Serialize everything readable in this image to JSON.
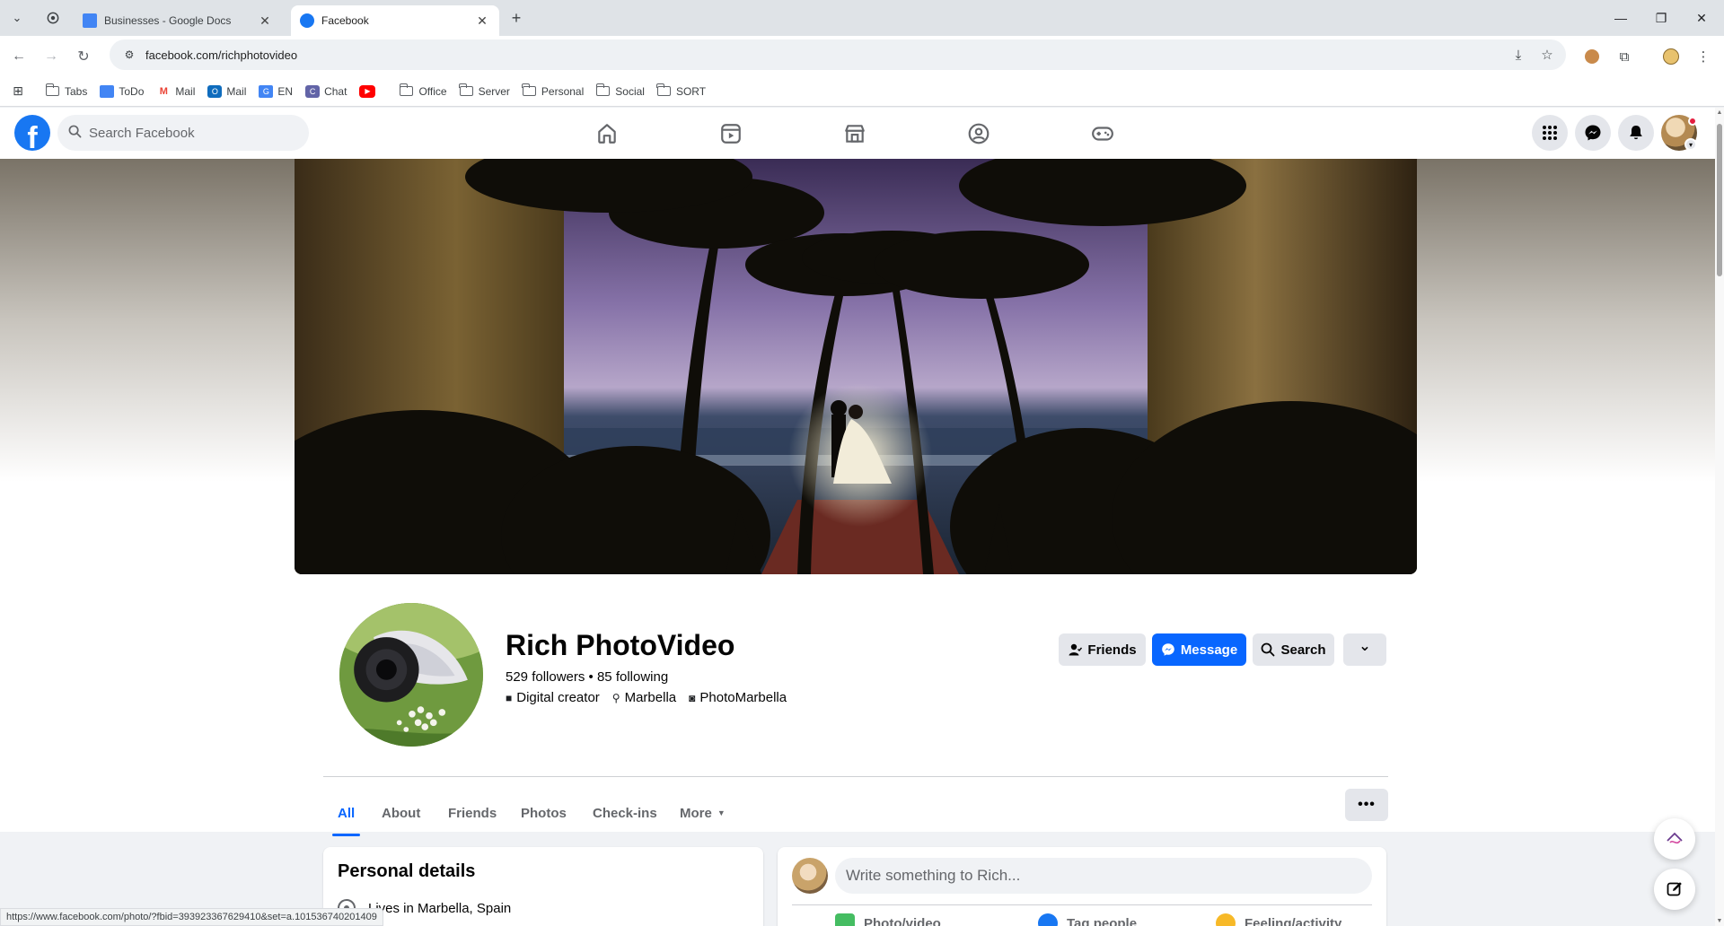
{
  "browser": {
    "tabs": [
      {
        "title": "Businesses - Google Docs"
      },
      {
        "title": "Facebook"
      }
    ],
    "new_tab": "+",
    "url": "facebook.com/richphotovideo",
    "bookmarks": [
      {
        "label": "Tabs"
      },
      {
        "label": "ToDo"
      },
      {
        "label": "Mail"
      },
      {
        "label": "Mail"
      },
      {
        "label": "EN"
      },
      {
        "label": "Chat"
      },
      {
        "label": "Office"
      },
      {
        "label": "Server"
      },
      {
        "label": "Personal"
      },
      {
        "label": "Social"
      },
      {
        "label": "SORT"
      }
    ],
    "status_url": "https://www.facebook.com/photo/?fbid=393923367629410&set=a.101536740201409"
  },
  "fb": {
    "search_placeholder": "Search Facebook",
    "nav_icons": [
      "home-icon",
      "video-icon",
      "marketplace-icon",
      "groups-icon",
      "gaming-icon"
    ],
    "header_buttons": [
      "menu-grid-icon",
      "messenger-icon",
      "notifications-bell-icon"
    ],
    "brand_color": "#0866ff"
  },
  "profile": {
    "name": "Rich PhotoVideo",
    "stats": "529 followers • 85 following",
    "tags": [
      "Digital creator",
      "Marbella",
      "PhotoMarbella"
    ],
    "buttons": {
      "friends": "Friends",
      "message": "Message",
      "search": "Search",
      "dropdown": "⌄"
    },
    "tabs": [
      "All",
      "About",
      "Friends",
      "Photos",
      "Check-ins",
      "More"
    ],
    "tabs_more_dots": "•••"
  },
  "personal_details": {
    "title": "Personal details",
    "lives_in": "Lives in Marbella, Spain"
  },
  "composer": {
    "placeholder": "Write something to Rich...",
    "actions": [
      "Photo/video",
      "Tag people",
      "Feeling/activity"
    ]
  }
}
